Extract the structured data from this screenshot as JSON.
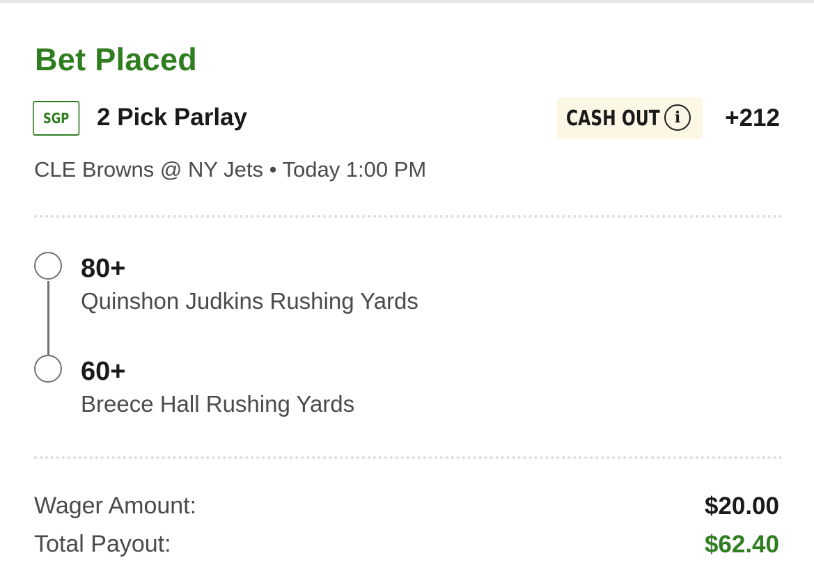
{
  "bet": {
    "status": "Bet Placed",
    "badge": "SGP",
    "title": "2 Pick Parlay",
    "cash_out_label": "CASH OUT",
    "odds": "+212",
    "game": "CLE Browns @ NY Jets • Today 1:00 PM"
  },
  "legs": [
    {
      "value": "80+",
      "description": "Quinshon Judkins Rushing Yards"
    },
    {
      "value": "60+",
      "description": "Breece Hall Rushing Yards"
    }
  ],
  "summary": {
    "wager_label": "Wager Amount:",
    "wager_value": "$20.00",
    "payout_label": "Total Payout:",
    "payout_value": "$62.40"
  },
  "colors": {
    "accent_green": "#2e7d1f",
    "cash_out_bg": "#fbf7e4",
    "text_primary": "#1a1a1a",
    "text_secondary": "#4a4a4a"
  },
  "icons": {
    "cash_out_info": "info-circle-icon",
    "leg_marker": "circle-outline-icon"
  }
}
